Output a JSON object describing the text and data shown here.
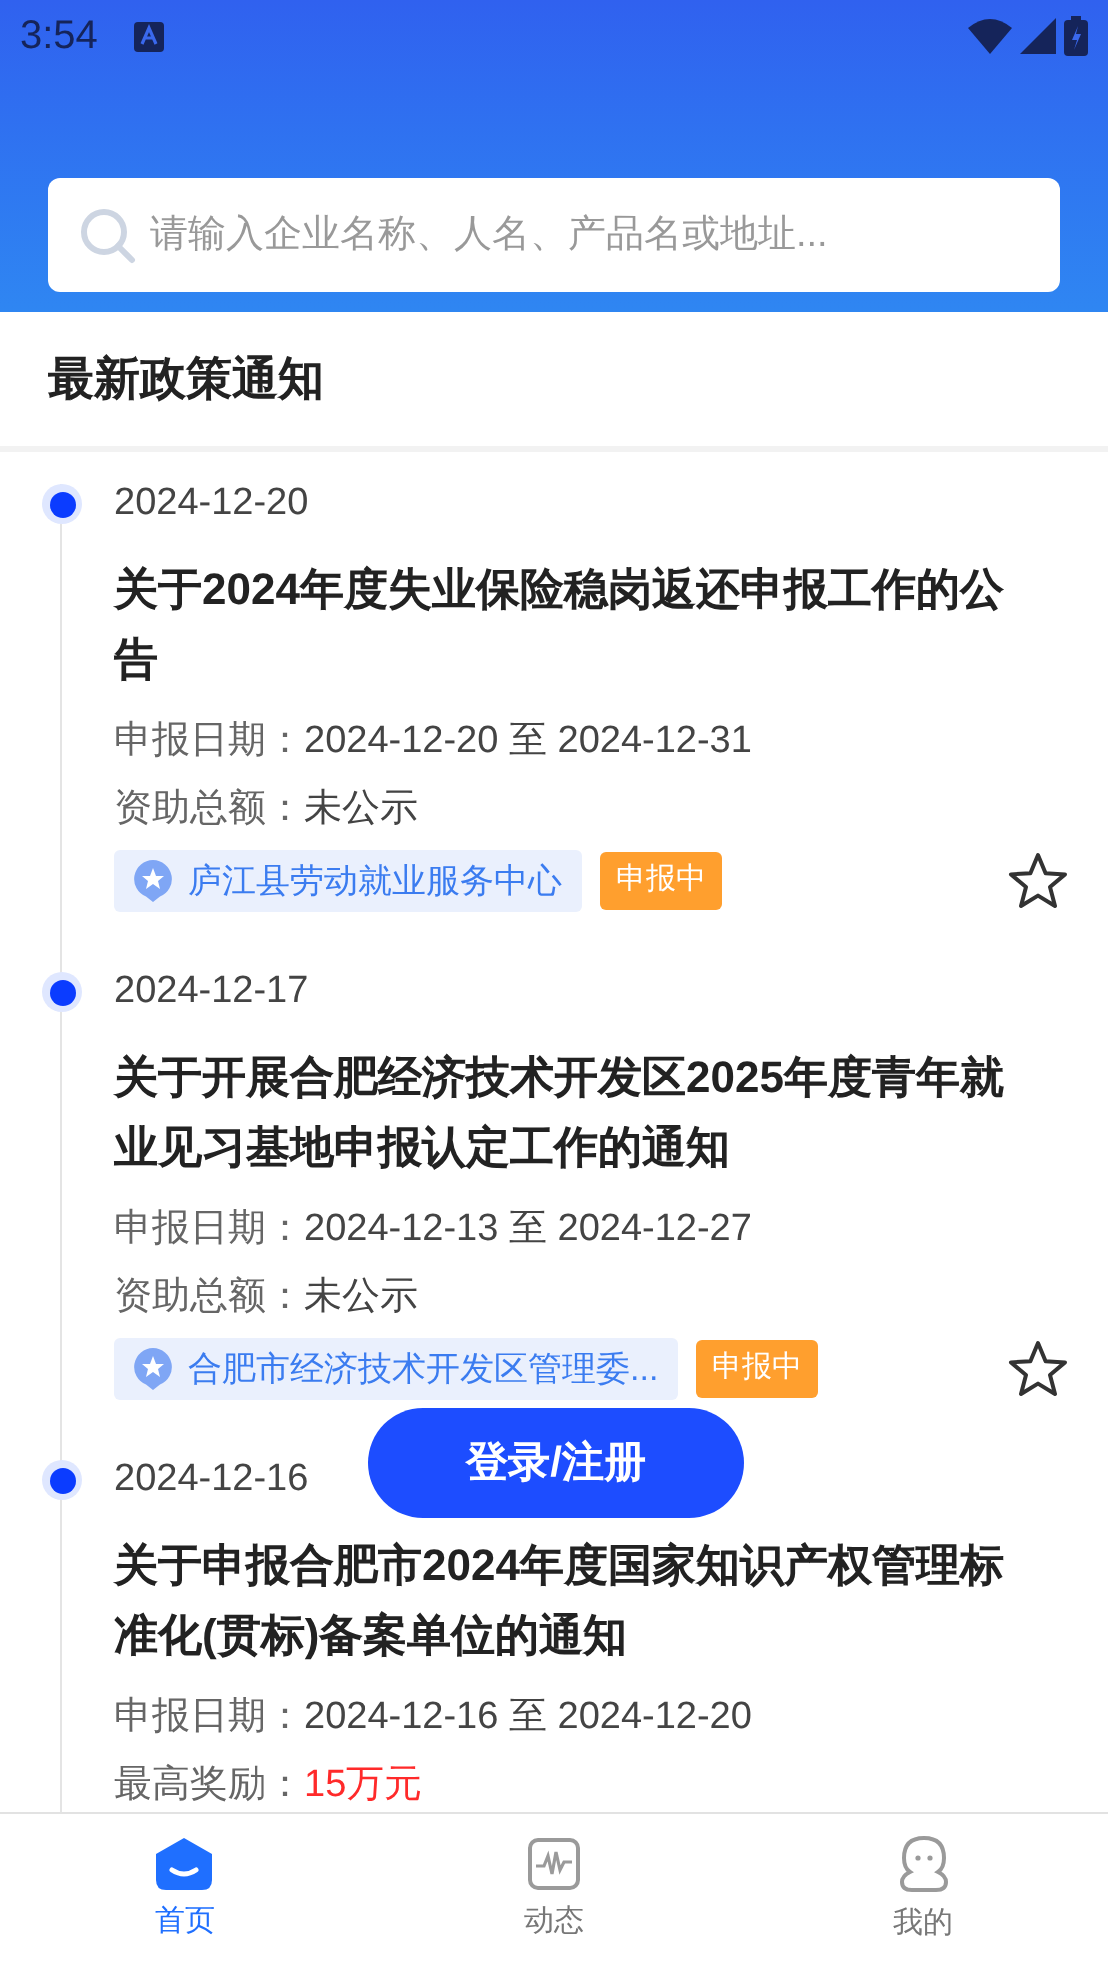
{
  "status_bar": {
    "time": "3:54"
  },
  "search": {
    "placeholder": "请输入企业名称、人名、产品名或地址..."
  },
  "section_title": "最新政策通知",
  "notices": [
    {
      "date": "2024-12-20",
      "title": "关于2024年度失业保险稳岗返还申报工作的公告",
      "meta": [
        {
          "label": "申报日期：",
          "value": "2024-12-20 至 2024-12-31",
          "highlight": false
        },
        {
          "label": "资助总额：",
          "value": "未公示",
          "highlight": false
        }
      ],
      "org": "庐江县劳动就业服务中心",
      "status": "申报中",
      "starred": false
    },
    {
      "date": "2024-12-17",
      "title": "关于开展合肥经济技术开发区2025年度青年就业见习基地申报认定工作的通知",
      "meta": [
        {
          "label": "申报日期：",
          "value": "2024-12-13 至 2024-12-27",
          "highlight": false
        },
        {
          "label": "资助总额：",
          "value": "未公示",
          "highlight": false
        }
      ],
      "org": "合肥市经济技术开发区管理委...",
      "status": "申报中",
      "starred": false
    },
    {
      "date": "2024-12-16",
      "title": "关于申报合肥市2024年度国家知识产权管理标准化(贯标)备案单位的通知",
      "meta": [
        {
          "label": "申报日期：",
          "value": "2024-12-16 至 2024-12-20",
          "highlight": false
        },
        {
          "label": "最高奖励：",
          "value": "15万元",
          "highlight": true
        }
      ]
    }
  ],
  "login_button": "登录/注册",
  "tabs": [
    {
      "label": "首页",
      "kind": "home",
      "selected": true
    },
    {
      "label": "动态",
      "kind": "activity",
      "selected": false
    },
    {
      "label": "我的",
      "kind": "profile",
      "selected": false
    }
  ]
}
